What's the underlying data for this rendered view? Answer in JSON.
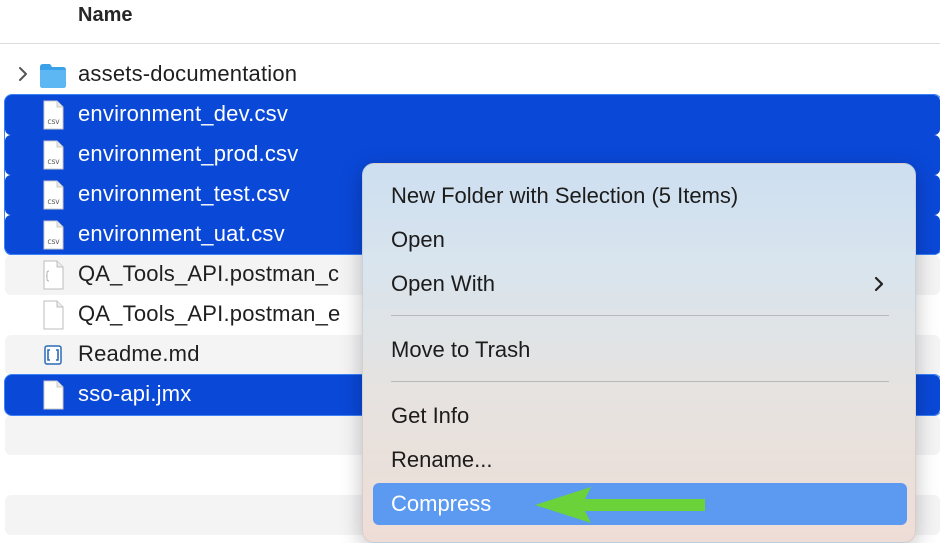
{
  "header": {
    "name_column": "Name"
  },
  "files": [
    {
      "name": "assets-documentation",
      "kind": "folder",
      "icon": "folder-icon",
      "selected": false,
      "disclosure": true
    },
    {
      "name": "environment_dev.csv",
      "kind": "csv",
      "icon": "csv-file-icon",
      "selected": true
    },
    {
      "name": "environment_prod.csv",
      "kind": "csv",
      "icon": "csv-file-icon",
      "selected": true
    },
    {
      "name": "environment_test.csv",
      "kind": "csv",
      "icon": "csv-file-icon",
      "selected": true
    },
    {
      "name": "environment_uat.csv",
      "kind": "csv",
      "icon": "csv-file-icon",
      "selected": true
    },
    {
      "name": "QA_Tools_API.postman_c",
      "kind": "json",
      "icon": "document-icon",
      "selected": false
    },
    {
      "name": "QA_Tools_API.postman_e",
      "kind": "json",
      "icon": "document-icon",
      "selected": false
    },
    {
      "name": "Readme.md",
      "kind": "md",
      "icon": "markdown-file-icon",
      "selected": false
    },
    {
      "name": "sso-api.jmx",
      "kind": "jmx",
      "icon": "document-icon",
      "selected": true
    }
  ],
  "csv_icon_text": "CSV",
  "context_menu": {
    "items": [
      {
        "label": "New Folder with Selection (5 Items)"
      },
      {
        "label": "Open"
      },
      {
        "label": "Open With",
        "submenu": true
      },
      {
        "label": "Move to Trash"
      },
      {
        "label": "Get Info"
      },
      {
        "label": "Rename..."
      },
      {
        "label": "Compress",
        "highlighted": true
      }
    ]
  },
  "colors": {
    "selection": "#0a48d8",
    "menu_highlight": "#5b9af0",
    "annotation_arrow": "#6bd23a"
  }
}
